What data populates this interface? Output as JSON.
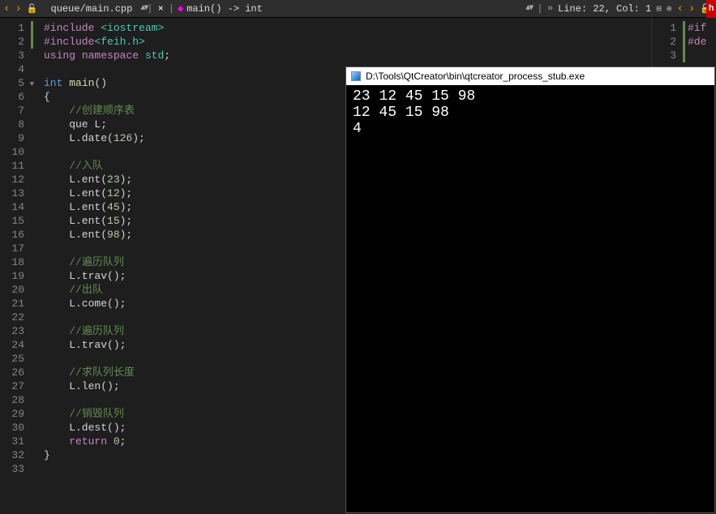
{
  "topbar": {
    "file_path": "queue/main.cpp",
    "function_sig": "main() -> int",
    "line_col": "Line: 22, Col: 1",
    "close": "×"
  },
  "code": {
    "lines": [
      {
        "n": 1,
        "m": true,
        "tokens": [
          [
            "pp",
            "#include"
          ],
          [
            "op",
            " "
          ],
          [
            "inc",
            "<iostream>"
          ]
        ]
      },
      {
        "n": 2,
        "m": true,
        "tokens": [
          [
            "pp",
            "#include"
          ],
          [
            "inc",
            "<feih.h>"
          ]
        ]
      },
      {
        "n": 3,
        "m": false,
        "tokens": [
          [
            "kw",
            "using"
          ],
          [
            "op",
            " "
          ],
          [
            "kw",
            "namespace"
          ],
          [
            "op",
            " "
          ],
          [
            "ns",
            "std"
          ],
          [
            "op",
            ";"
          ]
        ]
      },
      {
        "n": 4,
        "m": false,
        "tokens": []
      },
      {
        "n": 5,
        "m": false,
        "fold": true,
        "tokens": [
          [
            "type",
            "int"
          ],
          [
            "op",
            " "
          ],
          [
            "func",
            "main"
          ],
          [
            "op",
            "()"
          ]
        ]
      },
      {
        "n": 6,
        "m": false,
        "tokens": [
          [
            "op",
            "{"
          ]
        ]
      },
      {
        "n": 7,
        "m": false,
        "tokens": [
          [
            "op",
            "    "
          ],
          [
            "cmt",
            "//创建顺序表"
          ]
        ]
      },
      {
        "n": 8,
        "m": false,
        "tokens": [
          [
            "op",
            "    que L;"
          ]
        ]
      },
      {
        "n": 9,
        "m": false,
        "tokens": [
          [
            "op",
            "    L.date("
          ],
          [
            "num",
            "126"
          ],
          [
            "op",
            ");"
          ]
        ]
      },
      {
        "n": 10,
        "m": false,
        "tokens": []
      },
      {
        "n": 11,
        "m": false,
        "tokens": [
          [
            "op",
            "    "
          ],
          [
            "cmt",
            "//入队"
          ]
        ]
      },
      {
        "n": 12,
        "m": false,
        "tokens": [
          [
            "op",
            "    L.ent("
          ],
          [
            "num",
            "23"
          ],
          [
            "op",
            ");"
          ]
        ]
      },
      {
        "n": 13,
        "m": false,
        "tokens": [
          [
            "op",
            "    L.ent("
          ],
          [
            "num",
            "12"
          ],
          [
            "op",
            ");"
          ]
        ]
      },
      {
        "n": 14,
        "m": false,
        "tokens": [
          [
            "op",
            "    L.ent("
          ],
          [
            "num",
            "45"
          ],
          [
            "op",
            ");"
          ]
        ]
      },
      {
        "n": 15,
        "m": false,
        "tokens": [
          [
            "op",
            "    L.ent("
          ],
          [
            "num",
            "15"
          ],
          [
            "op",
            ");"
          ]
        ]
      },
      {
        "n": 16,
        "m": false,
        "tokens": [
          [
            "op",
            "    L.ent("
          ],
          [
            "num",
            "98"
          ],
          [
            "op",
            ");"
          ]
        ]
      },
      {
        "n": 17,
        "m": false,
        "tokens": []
      },
      {
        "n": 18,
        "m": false,
        "tokens": [
          [
            "op",
            "    "
          ],
          [
            "cmt",
            "//遍历队列"
          ]
        ]
      },
      {
        "n": 19,
        "m": false,
        "tokens": [
          [
            "op",
            "    L.trav();"
          ]
        ]
      },
      {
        "n": 20,
        "m": false,
        "tokens": [
          [
            "op",
            "    "
          ],
          [
            "cmt",
            "//出队"
          ]
        ]
      },
      {
        "n": 21,
        "m": false,
        "tokens": [
          [
            "op",
            "    L.come();"
          ]
        ]
      },
      {
        "n": 22,
        "m": false,
        "tokens": []
      },
      {
        "n": 23,
        "m": false,
        "tokens": [
          [
            "op",
            "    "
          ],
          [
            "cmt",
            "//遍历队列"
          ]
        ]
      },
      {
        "n": 24,
        "m": false,
        "tokens": [
          [
            "op",
            "    L.trav();"
          ]
        ]
      },
      {
        "n": 25,
        "m": false,
        "tokens": []
      },
      {
        "n": 26,
        "m": false,
        "tokens": [
          [
            "op",
            "    "
          ],
          [
            "cmt",
            "//求队列长度"
          ]
        ]
      },
      {
        "n": 27,
        "m": false,
        "tokens": [
          [
            "op",
            "    L.len();"
          ]
        ]
      },
      {
        "n": 28,
        "m": false,
        "tokens": []
      },
      {
        "n": 29,
        "m": false,
        "tokens": [
          [
            "op",
            "    "
          ],
          [
            "cmt",
            "//销毁队列"
          ]
        ]
      },
      {
        "n": 30,
        "m": false,
        "tokens": [
          [
            "op",
            "    L.dest();"
          ]
        ]
      },
      {
        "n": 31,
        "m": false,
        "tokens": [
          [
            "op",
            "    "
          ],
          [
            "kw",
            "return"
          ],
          [
            "op",
            " "
          ],
          [
            "num",
            "0"
          ],
          [
            "op",
            ";"
          ]
        ]
      },
      {
        "n": 32,
        "m": false,
        "tokens": [
          [
            "op",
            "}"
          ]
        ]
      },
      {
        "n": 33,
        "m": false,
        "tokens": []
      }
    ]
  },
  "secondary_code": {
    "lines": [
      {
        "n": 1,
        "m": true,
        "tokens": [
          [
            "pp",
            "#if"
          ]
        ]
      },
      {
        "n": 2,
        "m": true,
        "tokens": [
          [
            "pp",
            "#de"
          ]
        ]
      },
      {
        "n": 3,
        "m": true,
        "tokens": []
      }
    ]
  },
  "console": {
    "title": "D:\\Tools\\QtCreator\\bin\\qtcreator_process_stub.exe",
    "output": [
      "23 12 45 15 98",
      "12 45 15 98",
      "4"
    ]
  }
}
